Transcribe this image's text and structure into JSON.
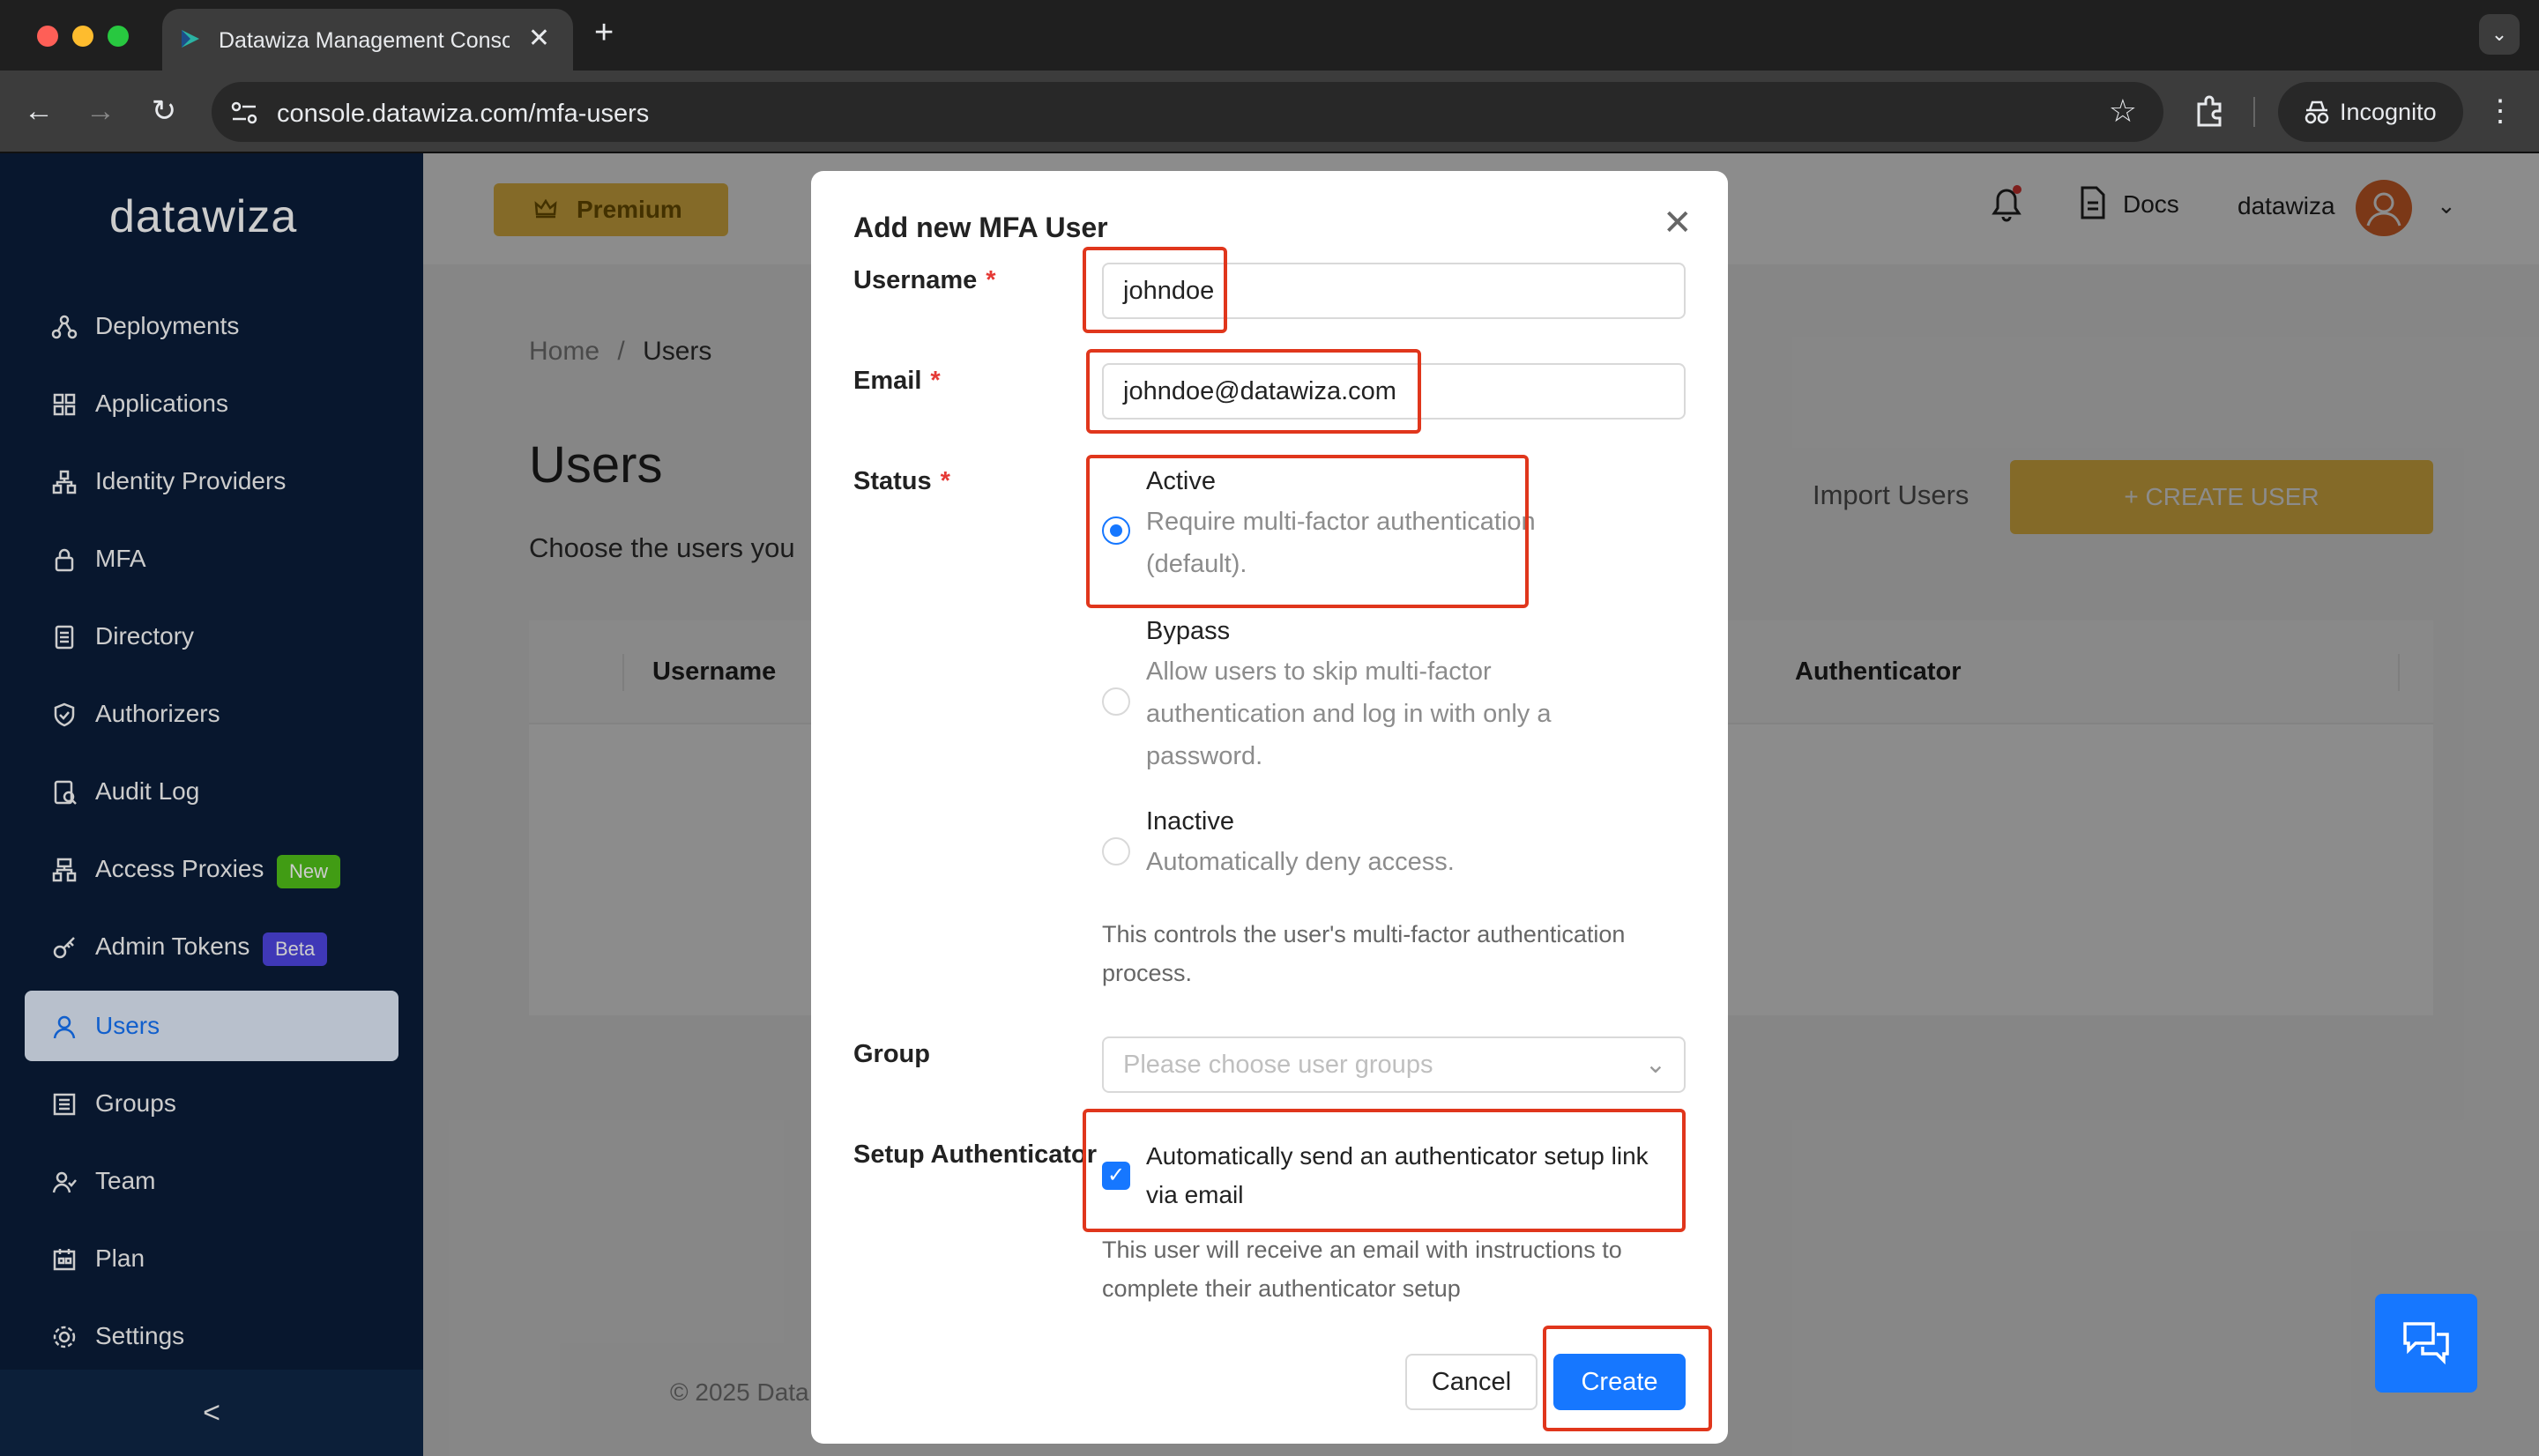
{
  "browser": {
    "tab_title": "Datawiza Management Conso",
    "url": "console.datawiza.com/mfa-users",
    "incognito_label": "Incognito"
  },
  "sidebar": {
    "logo": "datawiza",
    "items": [
      {
        "label": "Deployments",
        "icon": "deployments-icon"
      },
      {
        "label": "Applications",
        "icon": "applications-icon"
      },
      {
        "label": "Identity Providers",
        "icon": "identity-providers-icon"
      },
      {
        "label": "MFA",
        "icon": "lock-icon"
      },
      {
        "label": "Directory",
        "icon": "directory-icon"
      },
      {
        "label": "Authorizers",
        "icon": "shield-icon"
      },
      {
        "label": "Audit Log",
        "icon": "audit-log-icon"
      },
      {
        "label": "Access Proxies",
        "icon": "access-proxies-icon",
        "badge": "New"
      },
      {
        "label": "Admin Tokens",
        "icon": "key-icon",
        "badge": "Beta"
      },
      {
        "label": "Users",
        "icon": "user-icon",
        "active": true
      },
      {
        "label": "Groups",
        "icon": "groups-icon"
      },
      {
        "label": "Team",
        "icon": "team-icon"
      },
      {
        "label": "Plan",
        "icon": "plan-icon"
      },
      {
        "label": "Settings",
        "icon": "gear-icon"
      }
    ],
    "badge_colors": {
      "new": "#52c41a",
      "beta": "#4f46e5"
    }
  },
  "header": {
    "premium_label": "Premium",
    "docs_label": "Docs",
    "username": "datawiza"
  },
  "page": {
    "breadcrumb_home": "Home",
    "breadcrumb_sep": "/",
    "breadcrumb_current": "Users",
    "title": "Users",
    "subtitle": "Choose the users you",
    "import_label": "Import Users",
    "create_user_label": "+ CREATE USER",
    "columns": [
      "Username",
      "Authenticator"
    ],
    "footer": "© 2025 Data"
  },
  "modal": {
    "title": "Add new MFA User",
    "username_label": "Username",
    "username_value": "johndoe",
    "email_label": "Email",
    "email_value": "johndoe@datawiza.com",
    "status_label": "Status",
    "required_mark": "*",
    "status_options": [
      {
        "title": "Active",
        "desc": "Require multi-factor authentication (default).",
        "selected": true
      },
      {
        "title": "Bypass",
        "desc": "Allow users to skip multi-factor authentication and log in with only a password.",
        "selected": false
      },
      {
        "title": "Inactive",
        "desc": "Automatically deny access.",
        "selected": false
      }
    ],
    "status_help": "This controls the user's multi-factor authentication process.",
    "group_label": "Group",
    "group_placeholder": "Please choose user groups",
    "setup_label": "Setup Authenticator",
    "setup_checkbox_label": "Automatically send an authenticator setup link via email",
    "setup_checked": true,
    "setup_help": "This user will receive an email with instructions to complete their authenticator setup",
    "cancel_label": "Cancel",
    "create_label": "Create"
  },
  "colors": {
    "accent": "#1677ff",
    "sidebar_bg": "#0a1d3a",
    "premium": "#f0c24a",
    "highlight": "#e0361c"
  }
}
